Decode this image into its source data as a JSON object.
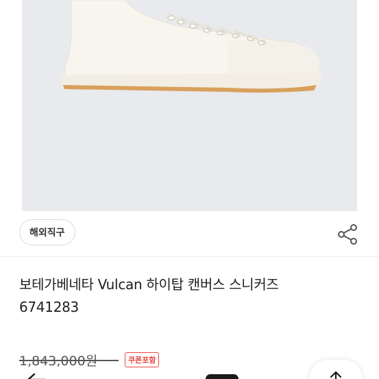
{
  "product": {
    "badge": "해외직구",
    "title_line1": "보테가베네타 Vulcan 하이탑 캔버스 스니커즈",
    "title_line2": "6741283",
    "original_price": "1,843,000원",
    "coupon_label": "쿠폰포함"
  },
  "icons": {
    "share": "share-icon",
    "back": "arrow-left-icon",
    "scroll_top": "arrow-up-icon"
  },
  "colors": {
    "image_background": "#e8eaed",
    "coupon": "#e8473d",
    "sole_accent": "#d9a05b"
  }
}
